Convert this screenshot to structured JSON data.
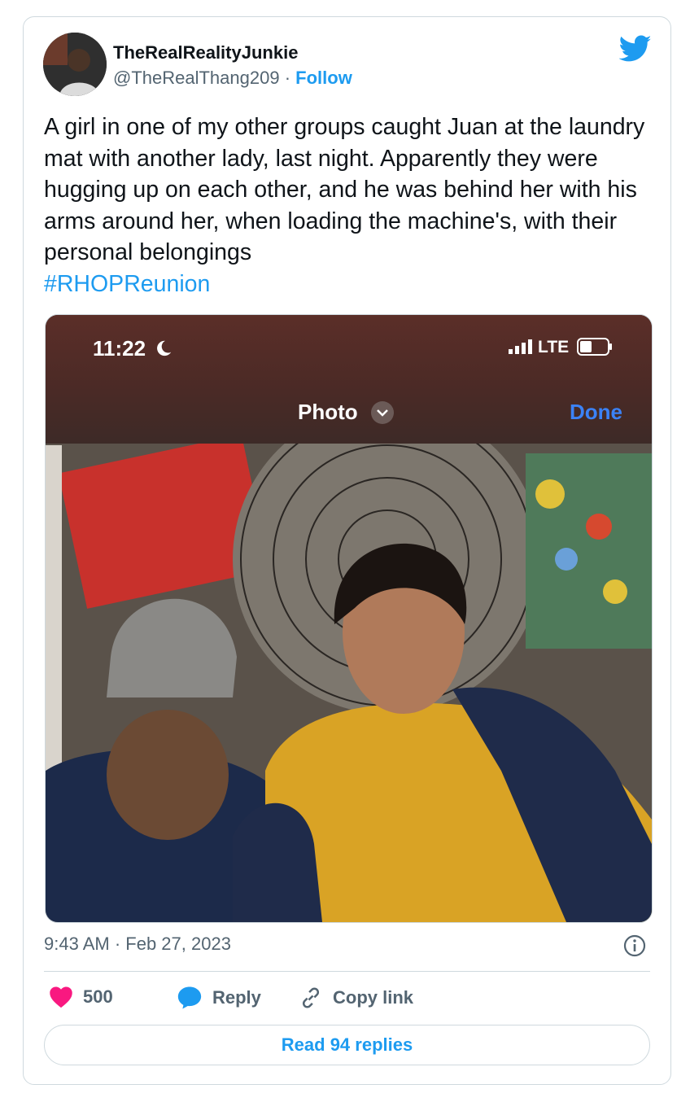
{
  "author": {
    "display_name": "TheRealRealityJunkie",
    "handle": "@TheRealThang209",
    "separator": "·",
    "follow_label": "Follow"
  },
  "tweet": {
    "text": "A girl in one of my other groups caught Juan at the laundry mat with another lady, last night. Apparently they were hugging up on each other, and he was behind her with his arms around her, when loading the machine's, with their personal belongings",
    "hashtag": "#RHOPReunion"
  },
  "media": {
    "status_time": "11:22",
    "network": "LTE",
    "photo_title": "Photo",
    "done_label": "Done"
  },
  "meta": {
    "timestamp": "9:43 AM · Feb 27, 2023"
  },
  "actions": {
    "like_count": "500",
    "reply_label": "Reply",
    "copy_link_label": "Copy link",
    "read_replies_label": "Read 94 replies"
  },
  "colors": {
    "accent": "#1d9bf0",
    "like": "#f91880",
    "muted": "#536471"
  },
  "icons": [
    "twitter-bird-icon",
    "moon-icon",
    "signal-icon",
    "battery-icon",
    "chevron-down-icon",
    "info-icon",
    "heart-icon",
    "reply-bubble-icon",
    "link-icon"
  ]
}
